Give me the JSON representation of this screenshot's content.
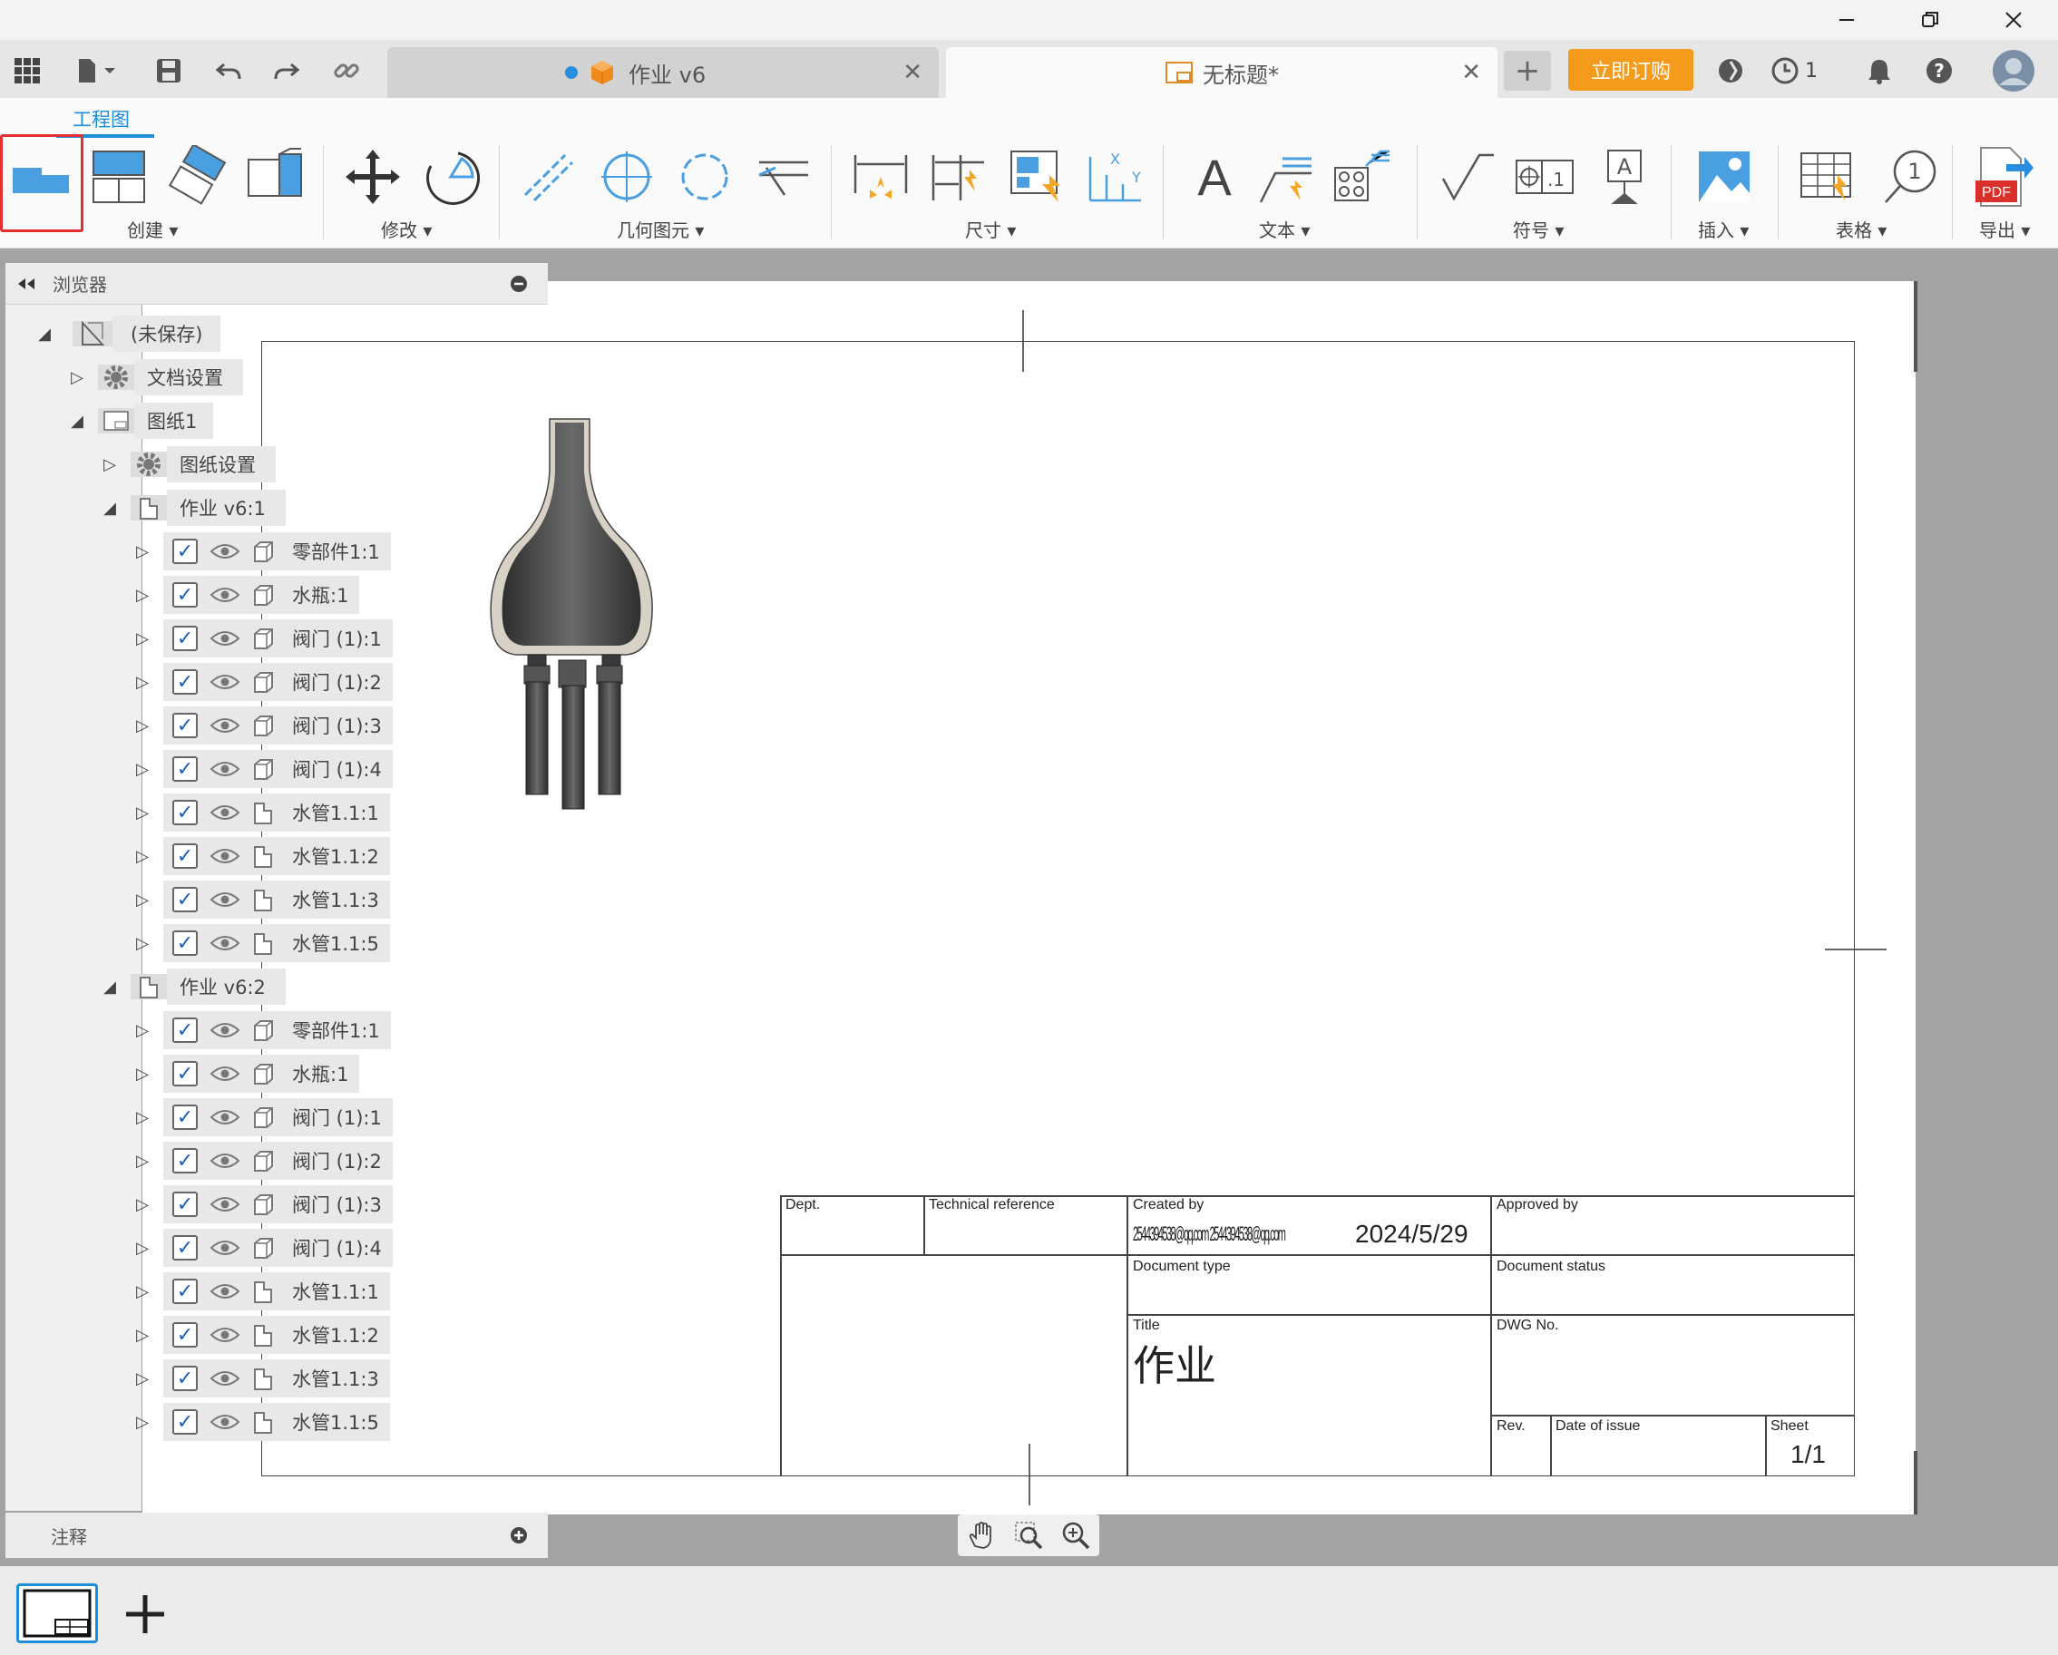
{
  "window": {
    "minimize_icon": "minimize-icon",
    "restore_icon": "restore-icon",
    "close_icon": "close-icon"
  },
  "tabs": [
    {
      "label": "作业 v6",
      "close": "✕"
    },
    {
      "label": "无标题*",
      "close": "✕"
    }
  ],
  "header": {
    "buy_label": "立即订购",
    "jobs_count": "1"
  },
  "ribbon": {
    "workspace": "工程图",
    "groups": {
      "create": "创建 ▾",
      "modify": "修改 ▾",
      "geometry": "几何图元 ▾",
      "dimensions": "尺寸 ▾",
      "text": "文本 ▾",
      "symbols": "符号 ▾",
      "insert": "插入 ▾",
      "table": "表格 ▾",
      "export": "导出 ▾"
    },
    "text_glyph": "A",
    "pdf_label": "PDF",
    "balloon_label": "1",
    "x_label": "X",
    "y_label": "Y",
    "symbol_label": ".1"
  },
  "browser": {
    "title": "浏览器",
    "root": "(未保存)",
    "doc_settings": "文档设置",
    "sheet": "图纸1",
    "sheet_settings": "图纸设置",
    "views": [
      {
        "label": "作业 v6:1",
        "items": [
          "零部件1:1",
          "水瓶:1",
          "阀门 (1):1",
          "阀门 (1):2",
          "阀门 (1):3",
          "阀门 (1):4",
          "水管1.1:1",
          "水管1.1:2",
          "水管1.1:3",
          "水管1.1:5"
        ]
      },
      {
        "label": "作业 v6:2",
        "items": [
          "零部件1:1",
          "水瓶:1",
          "阀门 (1):1",
          "阀门 (1):2",
          "阀门 (1):3",
          "阀门 (1):4",
          "水管1.1:1",
          "水管1.1:2",
          "水管1.1:3",
          "水管1.1:5"
        ]
      }
    ],
    "annotations": "注释"
  },
  "title_block": {
    "dept": "Dept.",
    "tech_ref": "Technical reference",
    "created_by": "Created by",
    "creator": "2544394538@qq.com 2544394538@qq.com",
    "date": "2024/5/29",
    "approved_by": "Approved by",
    "doc_type": "Document type",
    "doc_status": "Document status",
    "title_label": "Title",
    "title_value": "作业",
    "dwg_no": "DWG No.",
    "rev": "Rev.",
    "date_of_issue": "Date of issue",
    "sheet_label": "Sheet",
    "sheet_value": "1/1"
  }
}
